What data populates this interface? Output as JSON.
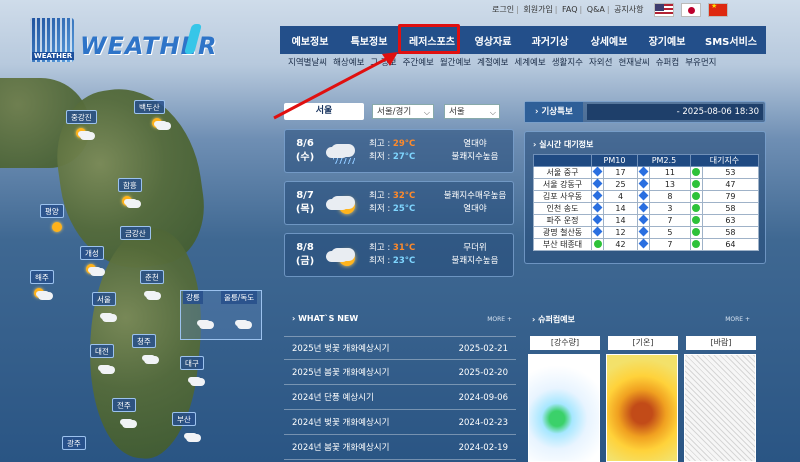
{
  "top_links": [
    "로그인",
    "회원가입",
    "FAQ",
    "Q&A",
    "공지사항"
  ],
  "flags": [
    {
      "name": "us-flag-icon"
    },
    {
      "name": "jp-flag-icon"
    },
    {
      "name": "cn-flag-icon"
    }
  ],
  "logo": {
    "text": "WEATHER",
    "sub": "WEATHER"
  },
  "nav": [
    "예보정보",
    "특보정보",
    "레저스포츠",
    "영상자료",
    "과거기상",
    "상세예보",
    "장기예보",
    "SMS서비스"
  ],
  "highlighted_nav": "레저스포츠",
  "subnav": [
    "지역별날씨",
    "해상예보",
    "그 정보",
    "주간예보",
    "월간예보",
    "계절예보",
    "세계예보",
    "생활지수",
    "자외선",
    "현재날씨",
    "슈퍼컴",
    "부유먼지"
  ],
  "map": {
    "cities": [
      "백두산",
      "중강진",
      "함흥",
      "평양",
      "금강산",
      "개성",
      "해주",
      "춘천",
      "서울",
      "강릉",
      "울릉/독도",
      "청주",
      "대전",
      "대구",
      "전주",
      "부산",
      "광주"
    ]
  },
  "location": {
    "city_tab": "서울",
    "region_select": "서울/경기",
    "city_select": "서울"
  },
  "forecast": [
    {
      "date": "8/6",
      "dow": "(수)",
      "hi_label": "최고 : ",
      "hi": "29°C",
      "lo_label": "최저 : ",
      "lo": "27°C",
      "desc1": "열대야",
      "desc2": "불쾌지수높음",
      "icon": "rain-cloud-icon"
    },
    {
      "date": "8/7",
      "dow": "(목)",
      "hi_label": "최고 : ",
      "hi": "32°C",
      "lo_label": "최저 : ",
      "lo": "25°C",
      "desc1": "불쾌지수매우높음",
      "desc2": "열대야",
      "icon": "partly-cloudy-icon"
    },
    {
      "date": "8/8",
      "dow": "(금)",
      "hi_label": "최고 : ",
      "hi": "31°C",
      "lo_label": "최저 : ",
      "lo": "23°C",
      "desc1": "무더위",
      "desc2": "불쾌지수높음",
      "icon": "partly-cloudy-icon"
    }
  ],
  "alert": {
    "title": "기상특보",
    "value": "- 2025-08-06 18:30"
  },
  "air": {
    "title": "실시간 대기정보",
    "headers": [
      "",
      "PM10",
      "PM2.5",
      "대기지수"
    ],
    "rows": [
      {
        "station": "서울 중구",
        "pm10": "17",
        "pm25": "11",
        "aqi": "53"
      },
      {
        "station": "서울 강동구",
        "pm10": "25",
        "pm25": "13",
        "aqi": "47"
      },
      {
        "station": "김포 사우동",
        "pm10": "4",
        "pm25": "8",
        "aqi": "79"
      },
      {
        "station": "인천 송도",
        "pm10": "14",
        "pm25": "3",
        "aqi": "58"
      },
      {
        "station": "파주 운정",
        "pm10": "14",
        "pm25": "7",
        "aqi": "63"
      },
      {
        "station": "광명 철산동",
        "pm10": "12",
        "pm25": "5",
        "aqi": "58"
      },
      {
        "station": "부산 태종대",
        "pm10": "42",
        "pm25": "7",
        "aqi": "64"
      }
    ],
    "colors": {
      "good": "#2a6fe0",
      "normal": "#2dc23a"
    }
  },
  "news": {
    "title": "WHAT`S NEW",
    "more": "MORE +",
    "items": [
      {
        "title": "2025년 벚꽃 개화예상시기",
        "date": "2025-02-21"
      },
      {
        "title": "2025년 봄꽃 개화예상시기",
        "date": "2025-02-20"
      },
      {
        "title": "2024년 단풍 예상시기",
        "date": "2024-09-06"
      },
      {
        "title": "2024년 벚꽃 개화예상시기",
        "date": "2024-02-23"
      },
      {
        "title": "2024년 봄꽃 개화예상시기",
        "date": "2024-02-19"
      }
    ]
  },
  "supercomputer": {
    "title": "슈퍼컴예보",
    "more": "MORE +",
    "labels": [
      "[강수량]",
      "[기온]",
      "[바람]"
    ]
  },
  "colors": {
    "nav_bg": "#234f8a",
    "highlight": "#e01010",
    "hi_temp": "#ff8a2a",
    "lo_temp": "#7fd6ff"
  }
}
